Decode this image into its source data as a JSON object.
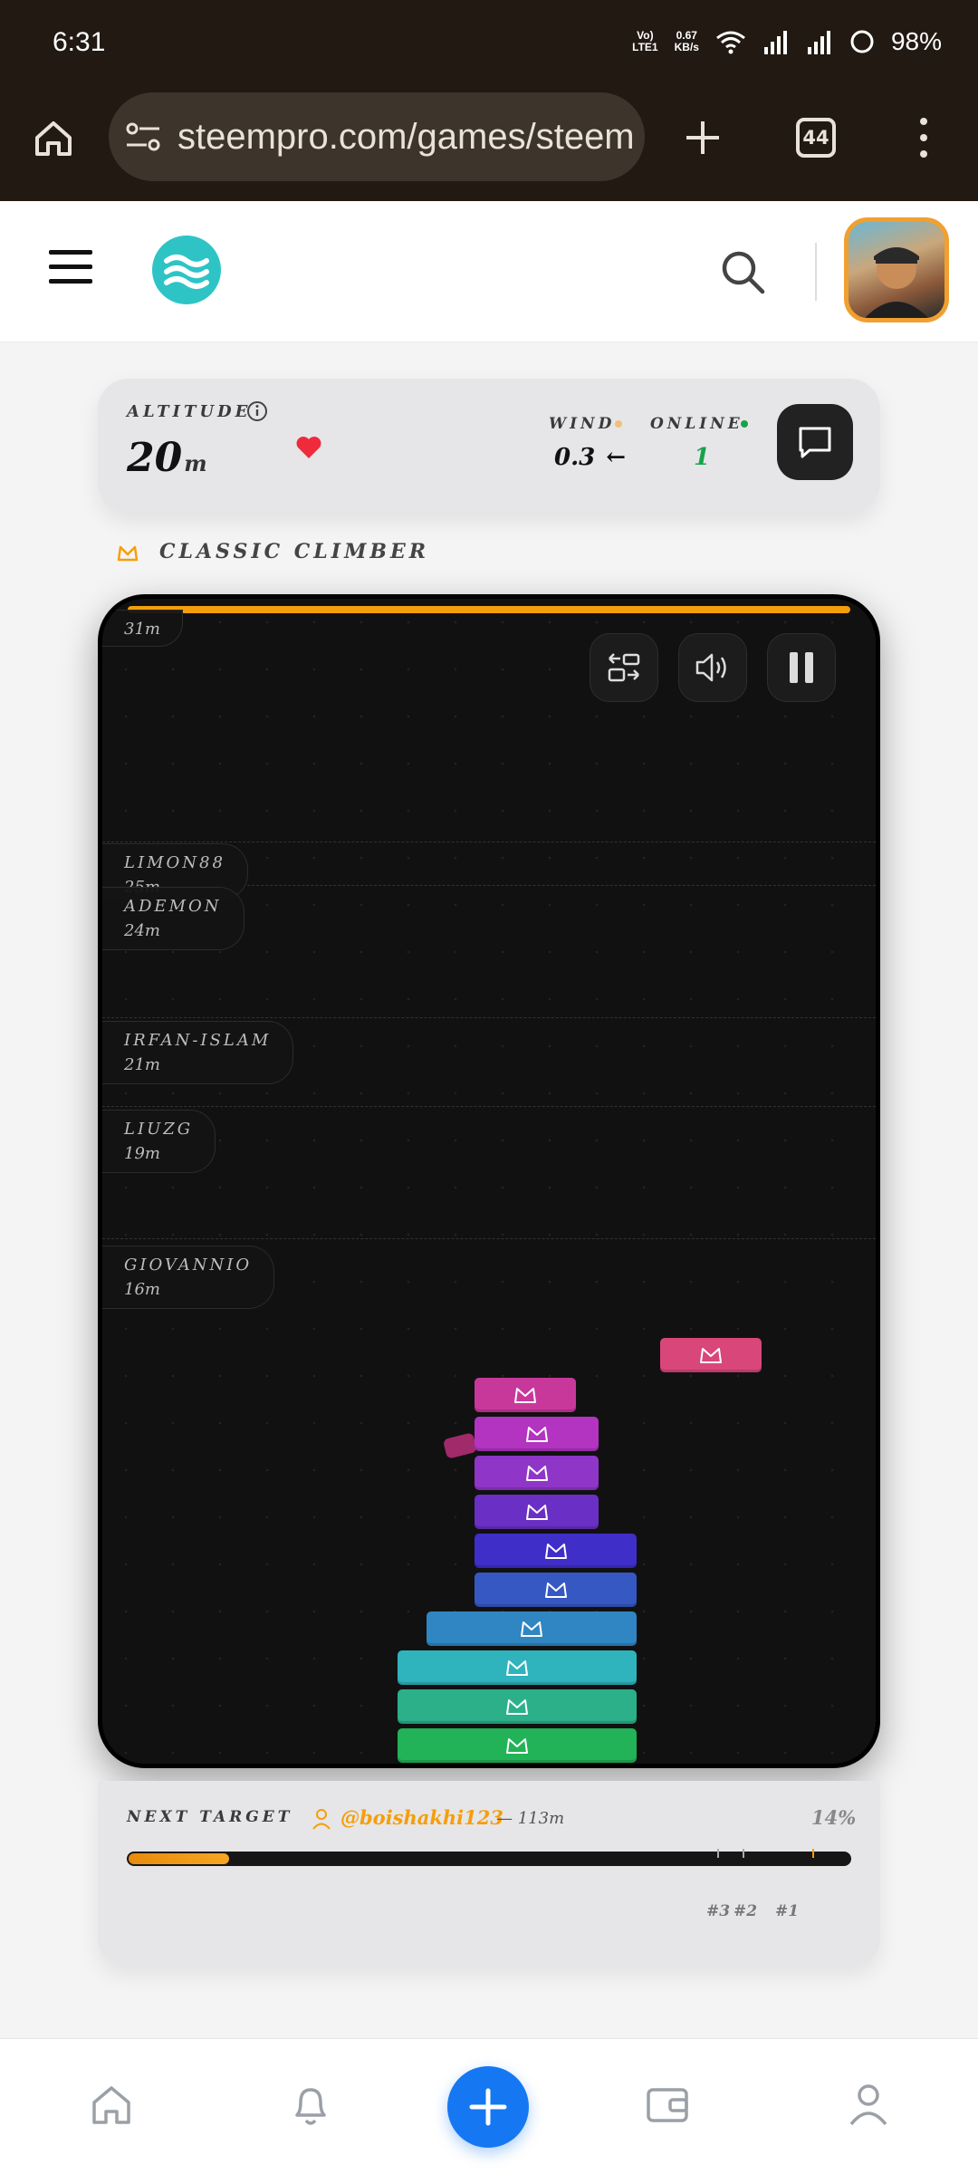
{
  "status_bar": {
    "time": "6:31",
    "net_top": "Vo)",
    "net_bottom": "LTE1",
    "speed_top": "0.67",
    "speed_bottom": "KB/s",
    "battery": "98%"
  },
  "browser": {
    "url": "steempro.com/games/steem",
    "tab_count": "44"
  },
  "altitude": {
    "label": "ALTITUDE",
    "value": "20",
    "unit": "m",
    "wind_label": "WIND",
    "wind_value": "0.3",
    "wind_arrow": "←",
    "online_label": "ONLINE",
    "online_value": "1"
  },
  "mode": {
    "label": "CLASSIC CLIMBER"
  },
  "board": {
    "top_ghost_height": "31m",
    "ghosts": [
      {
        "name": "LIMON88",
        "height": "25m"
      },
      {
        "name": "ADEMON",
        "height": "24m"
      },
      {
        "name": "IRFAN-ISLAM",
        "height": "21m"
      },
      {
        "name": "LIUZG",
        "height": "19m"
      },
      {
        "name": "GIOVANNIO",
        "height": "16m"
      }
    ]
  },
  "next_target": {
    "label": "NEXT TARGET",
    "user": "@boishakhi123",
    "distance": "— 113m",
    "percent": "14%",
    "progress": 0.14,
    "markers": [
      "#3",
      "#2",
      "#1"
    ]
  },
  "colors": {
    "accent": "#f59e0b",
    "online": "#16a34a",
    "fab": "#1677f2"
  }
}
